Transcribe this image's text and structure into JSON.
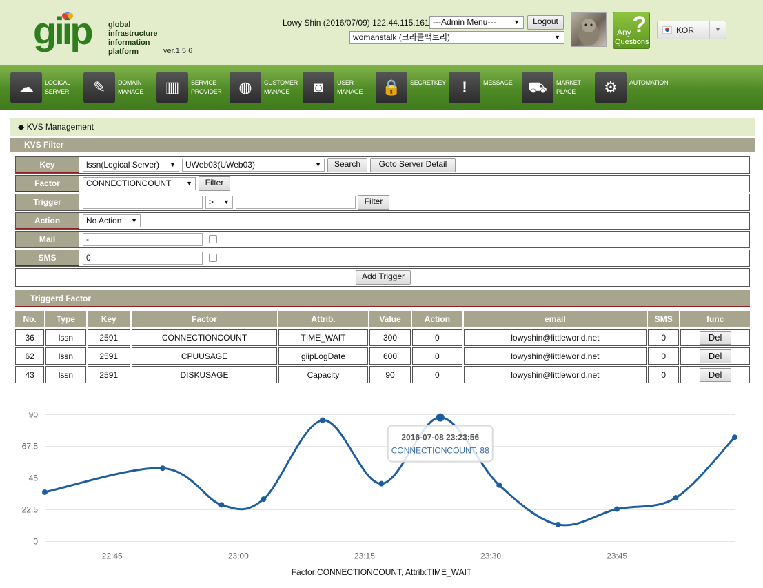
{
  "header": {
    "logo_text": "giip",
    "logo_lines": [
      "global",
      "infrastructure",
      "information",
      "platform"
    ],
    "version": "ver.1.5.6",
    "user_info": "Lowy Shin (2016/07/09) 122.44.115.161",
    "admin_menu": "---Admin Menu---",
    "logout": "Logout",
    "project": "womanstalk (크라클팩토리)",
    "any_q_line1": "Any",
    "any_q_line2": "Questions",
    "any_q_mark": "?",
    "lang": "KOR"
  },
  "nav": [
    {
      "label": "LOGICAL\nSERVER",
      "icon": "server-cloud-icon",
      "glyph": "☁"
    },
    {
      "label": "DOMAIN\nMANAGE",
      "icon": "www-brush-icon",
      "glyph": "✎"
    },
    {
      "label": "SERVICE\nPROVIDER",
      "icon": "building-icon",
      "glyph": "▥"
    },
    {
      "label": "CUSTOMER\nMANAGE",
      "icon": "globe-gear-icon",
      "glyph": "◍"
    },
    {
      "label": "USER\nMANAGE",
      "icon": "user-card-icon",
      "glyph": "◙"
    },
    {
      "label": "SECRETKEY",
      "icon": "lock-icon",
      "glyph": "🔒"
    },
    {
      "label": "MESSAGE",
      "icon": "message-icon",
      "glyph": "!"
    },
    {
      "label": "MARKET\nPLACE",
      "icon": "cart-icon",
      "glyph": "⛟"
    },
    {
      "label": "AUTOMATION",
      "icon": "gears-icon",
      "glyph": "⚙"
    }
  ],
  "page": {
    "title_bullet": "◆",
    "title": "KVS Management",
    "filter_title": "KVS Filter",
    "triggered_title": "Triggerd Factor"
  },
  "form": {
    "key_label": "Key",
    "key_type": "lssn(Logical Server)",
    "key_value": "UWeb03(UWeb03)",
    "search": "Search",
    "goto": "Goto Server Detail",
    "factor_label": "Factor",
    "factor_value": "CONNECTIONCOUNT",
    "filter": "Filter",
    "trigger_label": "Trigger",
    "trigger_op": ">",
    "action_label": "Action",
    "action_value": "No Action",
    "mail_label": "Mail",
    "mail_value": "-",
    "sms_label": "SMS",
    "sms_value": "0",
    "add_trigger": "Add Trigger"
  },
  "table": {
    "headers": [
      "No.",
      "Type",
      "Key",
      "Factor",
      "Attrib.",
      "Value",
      "Action",
      "email",
      "SMS",
      "func"
    ],
    "rows": [
      [
        "36",
        "lssn",
        "2591",
        "CONNECTIONCOUNT",
        "TIME_WAIT",
        "300",
        "0",
        "lowyshin@littleworld.net",
        "0",
        "Del"
      ],
      [
        "62",
        "lssn",
        "2591",
        "CPUUSAGE",
        "giipLogDate",
        "600",
        "0",
        "lowyshin@littleworld.net",
        "0",
        "Del"
      ],
      [
        "43",
        "lssn",
        "2591",
        "DISKUSAGE",
        "Capacity",
        "90",
        "0",
        "lowyshin@littleworld.net",
        "0",
        "Del"
      ]
    ]
  },
  "chart_data": {
    "type": "line",
    "x": [
      "22:37",
      "22:51",
      "22:58",
      "23:03",
      "23:10",
      "23:17",
      "23:24",
      "23:31",
      "23:38",
      "23:45",
      "23:52",
      "23:59"
    ],
    "series": [
      {
        "name": "CONNECTIONCOUNT",
        "values": [
          35,
          52,
          26,
          30,
          86,
          41,
          88,
          40,
          12,
          23,
          31,
          74
        ],
        "color": "#1f5e9e"
      }
    ],
    "ylim": [
      0,
      90
    ],
    "yticks": [
      "0",
      "22.5",
      "45",
      "67.5",
      "90"
    ],
    "xticks": [
      "22:45",
      "23:00",
      "23:15",
      "23:30",
      "23:45"
    ],
    "grid": true,
    "tooltip_date": "2016-07-08 23:23:56",
    "tooltip_value": "CONNECTIONCOUNT: 88",
    "caption": "Factor:CONNECTIONCOUNT, Attrib:TIME_WAIT"
  }
}
